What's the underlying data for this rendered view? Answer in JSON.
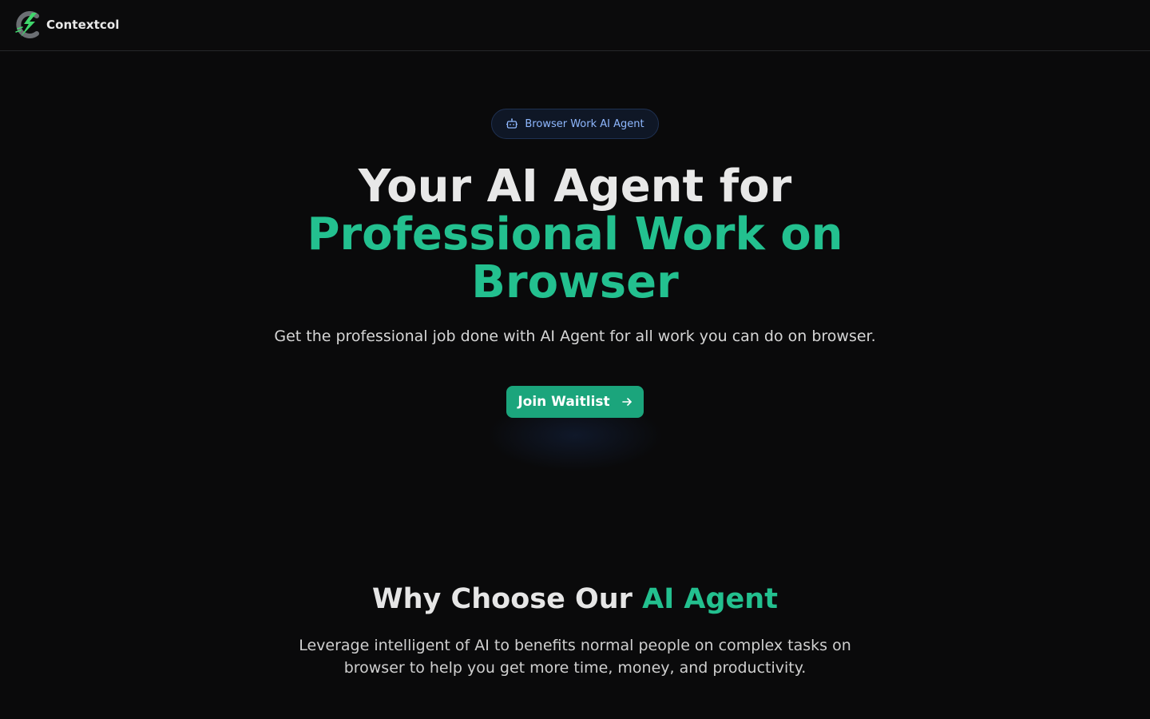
{
  "header": {
    "brand_name": "Contextcol",
    "logo_icon": "lightning-c-logo-icon"
  },
  "hero": {
    "badge": {
      "icon": "robot-icon",
      "label": "Browser Work AI Agent"
    },
    "title_line1": "Your AI Agent for",
    "title_line2": "Professional Work on",
    "title_line3": "Browser",
    "subtitle": "Get the professional job done with AI Agent for all work you can do on browser.",
    "cta": {
      "label": "Join Waitlist",
      "icon": "arrow-right-icon"
    }
  },
  "why_section": {
    "title_prefix": "Why Choose Our ",
    "title_accent": "AI Agent",
    "description": "Leverage intelligent of AI to benefits normal people on complex tasks on browser to help you get more time, money, and productivity."
  },
  "colors": {
    "background": "#0a0a0b",
    "accent_green": "#23c08f",
    "button_green": "#1ba57c",
    "badge_bg": "#0f1726",
    "badge_text": "#8fb8ff"
  }
}
